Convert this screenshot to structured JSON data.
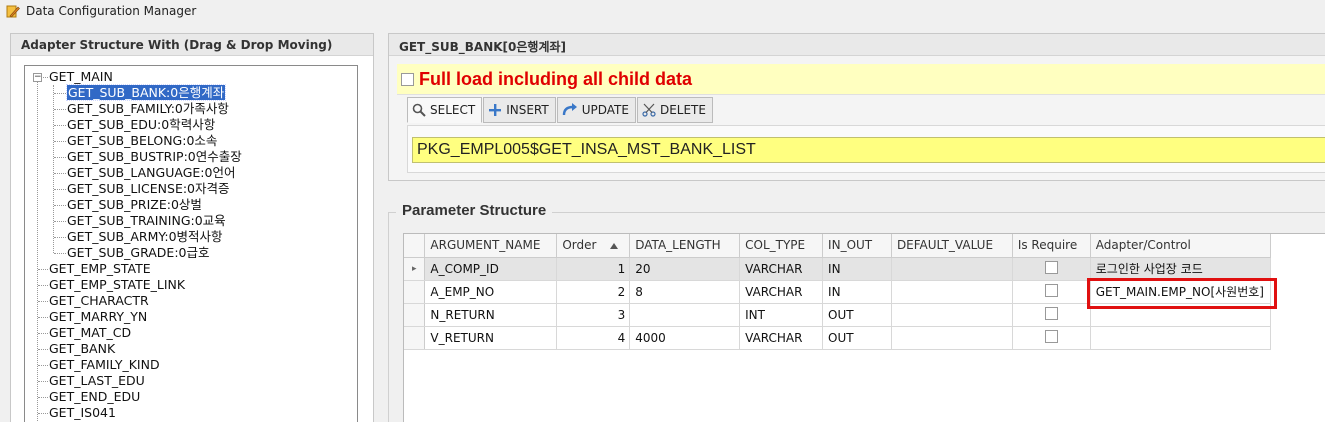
{
  "window": {
    "title": "Data Configuration Manager",
    "icon": "pencil-app-icon"
  },
  "left_panel": {
    "header": "Adapter Structure With (Drag & Drop Moving)",
    "tree": [
      {
        "label": "GET_MAIN",
        "level": 0,
        "expanded": true
      },
      {
        "label": "GET_SUB_BANK:0은행계좌",
        "level": 1,
        "selected": true
      },
      {
        "label": "GET_SUB_FAMILY:0가족사항",
        "level": 1
      },
      {
        "label": "GET_SUB_EDU:0학력사항",
        "level": 1
      },
      {
        "label": "GET_SUB_BELONG:0소속",
        "level": 1
      },
      {
        "label": "GET_SUB_BUSTRIP:0연수출장",
        "level": 1
      },
      {
        "label": "GET_SUB_LANGUAGE:0언어",
        "level": 1
      },
      {
        "label": "GET_SUB_LICENSE:0자격증",
        "level": 1
      },
      {
        "label": "GET_SUB_PRIZE:0상벌",
        "level": 1
      },
      {
        "label": "GET_SUB_TRAINING:0교육",
        "level": 1
      },
      {
        "label": "GET_SUB_ARMY:0병적사항",
        "level": 1
      },
      {
        "label": "GET_SUB_GRADE:0급호",
        "level": 1
      },
      {
        "label": "GET_EMP_STATE",
        "level": 0
      },
      {
        "label": "GET_EMP_STATE_LINK",
        "level": 0
      },
      {
        "label": "GET_CHARACTR",
        "level": 0
      },
      {
        "label": "GET_MARRY_YN",
        "level": 0
      },
      {
        "label": "GET_MAT_CD",
        "level": 0
      },
      {
        "label": "GET_BANK",
        "level": 0
      },
      {
        "label": "GET_FAMILY_KIND",
        "level": 0
      },
      {
        "label": "GET_LAST_EDU",
        "level": 0
      },
      {
        "label": "GET_END_EDU",
        "level": 0
      },
      {
        "label": "GET_IS041",
        "level": 0
      }
    ]
  },
  "right_top": {
    "header": "GET_SUB_BANK[0은행계좌]",
    "full_load_label": "Full load including all child data",
    "full_load_checked": false,
    "tabs": [
      {
        "label": "SELECT",
        "icon": "search-icon",
        "active": true
      },
      {
        "label": "INSERT",
        "icon": "plus-icon"
      },
      {
        "label": "UPDATE",
        "icon": "redo-arrow-icon"
      },
      {
        "label": "DELETE",
        "icon": "scissors-icon"
      }
    ],
    "query": "PKG_EMPL005$GET_INSA_MST_BANK_LIST"
  },
  "params": {
    "title": "Parameter Structure",
    "columns": [
      "ARGUMENT_NAME",
      "Order",
      "DATA_LENGTH",
      "COL_TYPE",
      "IN_OUT",
      "DEFAULT_VALUE",
      "Is Require",
      "Adapter/Control"
    ],
    "rows": [
      {
        "arg": "A_COMP_ID",
        "order": "1",
        "length": "20",
        "type": "VARCHAR",
        "inout": "IN",
        "default": "",
        "require": false,
        "adapter": "로그인한 사업장 코드"
      },
      {
        "arg": "A_EMP_NO",
        "order": "2",
        "length": "8",
        "type": "VARCHAR",
        "inout": "IN",
        "default": "",
        "require": false,
        "adapter": "GET_MAIN.EMP_NO[사원번호]"
      },
      {
        "arg": "N_RETURN",
        "order": "3",
        "length": "",
        "type": "INT",
        "inout": "OUT",
        "default": "",
        "require": false,
        "adapter": ""
      },
      {
        "arg": "V_RETURN",
        "order": "4",
        "length": "4000",
        "type": "VARCHAR",
        "inout": "OUT",
        "default": "",
        "require": false,
        "adapter": ""
      }
    ],
    "current_row_marker": "▸",
    "highlight_color": "#e01010"
  }
}
